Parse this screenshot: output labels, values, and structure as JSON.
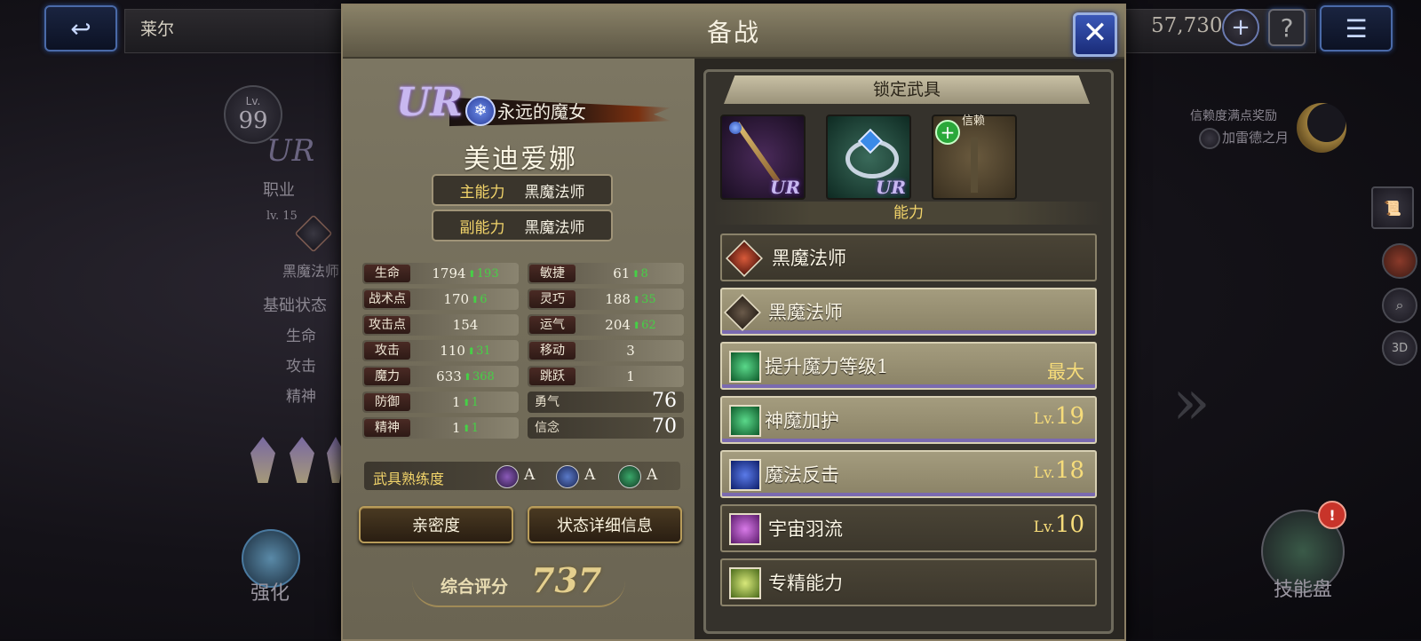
{
  "top_bar": {
    "player_name": "莱尔",
    "currency": "57,730",
    "help_label": "?"
  },
  "background": {
    "level_label": "Lv.",
    "level_value": "99",
    "job_label": "职业",
    "job_level": "lv. 15",
    "job_name": "黑魔法师",
    "base_status": "基础状态",
    "stat_hp": "生命",
    "stat_atk": "攻击",
    "stat_spr": "精神",
    "trust_reward": "信赖度满点奖励",
    "trust_item": "加雷德之月",
    "enhance": "强化",
    "skill_board": "技能盘",
    "view_3d": "3D",
    "notify": "!"
  },
  "dialog": {
    "title": "备战",
    "close": "✕",
    "unit_rarity": "UR",
    "unit_title": "永远的魔女",
    "unit_name": "美迪爱娜",
    "main_job_label": "主能力",
    "main_job": "黑魔法师",
    "sub_job_label": "副能力",
    "sub_job": "黑魔法师",
    "stats_left": [
      {
        "label": "生命",
        "value": "1794",
        "bonus": "193"
      },
      {
        "label": "战术点",
        "value": "170",
        "bonus": "6"
      },
      {
        "label": "攻击点",
        "value": "154",
        "bonus": ""
      },
      {
        "label": "攻击",
        "value": "110",
        "bonus": "31"
      },
      {
        "label": "魔力",
        "value": "633",
        "bonus": "368"
      },
      {
        "label": "防御",
        "value": "1",
        "bonus": "1"
      },
      {
        "label": "精神",
        "value": "1",
        "bonus": "1"
      }
    ],
    "stats_right": [
      {
        "label": "敏捷",
        "value": "61",
        "bonus": "8"
      },
      {
        "label": "灵巧",
        "value": "188",
        "bonus": "35"
      },
      {
        "label": "运气",
        "value": "204",
        "bonus": "62"
      },
      {
        "label": "移动",
        "value": "3",
        "bonus": ""
      },
      {
        "label": "跳跃",
        "value": "1",
        "bonus": ""
      }
    ],
    "bravery_label": "勇气",
    "bravery_value": "76",
    "faith_label": "信念",
    "faith_value": "70",
    "proficiency_label": "武具熟练度",
    "proficiency": [
      "A",
      "A",
      "A"
    ],
    "affinity_button": "亲密度",
    "detail_button": "状态详细信息",
    "score_label": "综合评分",
    "score_value": "737",
    "locked_gear_title": "锁定武具",
    "gear_ur": "UR",
    "trust_slot_label": "信赖",
    "ability_title": "能力",
    "abilities": [
      {
        "name": "黑魔法师",
        "level_prefix": "",
        "level": ""
      },
      {
        "name": "黑魔法师",
        "level_prefix": "",
        "level": ""
      },
      {
        "name": "提升魔力等级1",
        "level_prefix": "",
        "level": "最大"
      },
      {
        "name": "神魔加护",
        "level_prefix": "Lv.",
        "level": "19"
      },
      {
        "name": "魔法反击",
        "level_prefix": "Lv.",
        "level": "18"
      },
      {
        "name": "宇宙羽流",
        "level_prefix": "Lv.",
        "level": "10"
      },
      {
        "name": "专精能力",
        "level_prefix": "",
        "level": ""
      }
    ]
  }
}
